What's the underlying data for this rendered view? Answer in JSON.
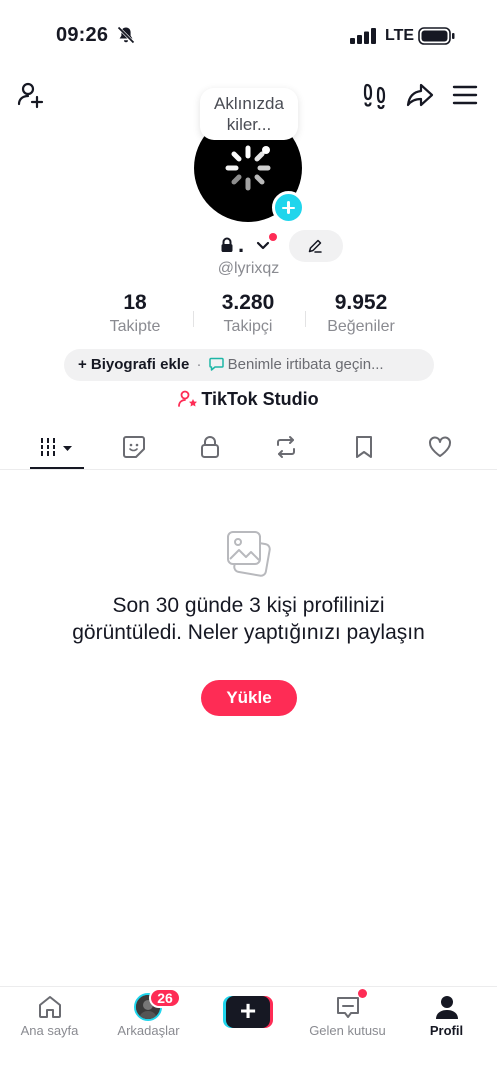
{
  "status_bar": {
    "time": "09:26",
    "network": "LTE"
  },
  "header": {
    "bubble_text_line1": "Aklınızda",
    "bubble_text_line2": "kiler..."
  },
  "profile": {
    "name_display": ".",
    "handle": "@lyrixqz",
    "stats": [
      {
        "value": "18",
        "label": "Takipte"
      },
      {
        "value": "3.280",
        "label": "Takipçi"
      },
      {
        "value": "9.952",
        "label": "Beğeniler"
      }
    ],
    "bio_add": "+ Biyografi ekle",
    "bio_separator": "·",
    "bio_contact": "Benimle irtibata geçin...",
    "studio_label": "TikTok Studio"
  },
  "empty_state": {
    "message": "Son 30 günde 3 kişi profilinizi görüntüledi. Neler yaptığınızı paylaşın",
    "button_label": "Yükle"
  },
  "bottom_nav": {
    "home": "Ana sayfa",
    "friends": "Arkadaşlar",
    "friends_badge": "26",
    "create": "+",
    "inbox": "Gelen kutusu",
    "profile": "Profil"
  },
  "colors": {
    "accent_red": "#fe2c55",
    "accent_cyan": "#20d5ec",
    "text_primary": "#161823",
    "text_secondary": "#8a8b91"
  }
}
